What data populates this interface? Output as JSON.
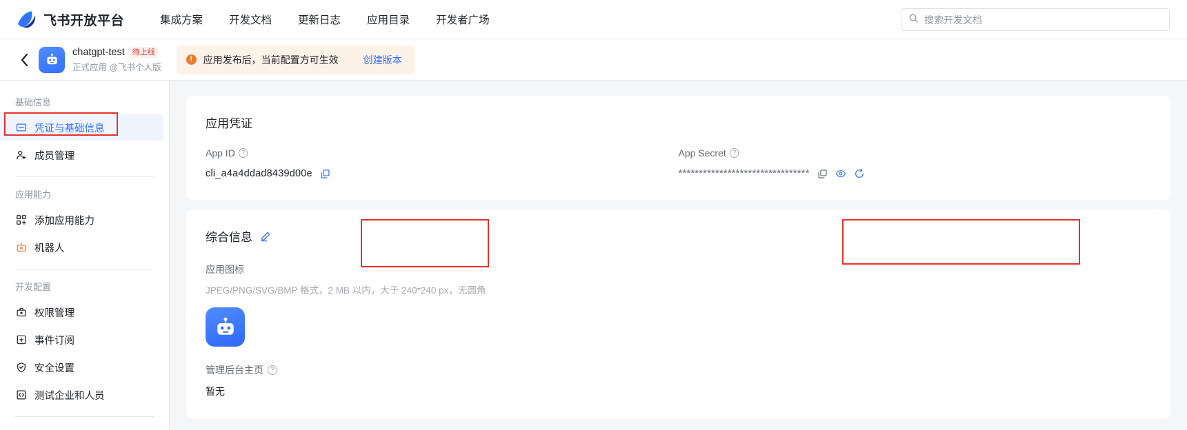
{
  "topnav": {
    "brand": "飞书开放平台",
    "links": [
      {
        "label": "集成方案"
      },
      {
        "label": "开发文档"
      },
      {
        "label": "更新日志"
      },
      {
        "label": "应用目录"
      },
      {
        "label": "开发者广场"
      }
    ],
    "search": {
      "placeholder": "搜索开发文档",
      "value": "",
      "icon": "search-icon"
    }
  },
  "app_header": {
    "back_icon": "chevron-left-icon",
    "app_icon": "robot-app-icon",
    "app_name": "chatgpt-test",
    "status_badge": "待上线",
    "app_subtitle": "正式应用 @飞书个人版",
    "banner": {
      "icon": "warning-icon",
      "text": "应用发布后，当前配置方可生效",
      "link_label": "创建版本",
      "bg_color": "#fdf2e8",
      "icon_color": "#ed7b2f",
      "link_color": "#3370ff"
    }
  },
  "sidebar": {
    "groups": [
      {
        "title": "基础信息",
        "items": [
          {
            "label": "凭证与基础信息",
            "icon": "credential-card-icon",
            "active": true
          },
          {
            "label": "成员管理",
            "icon": "user-add-icon",
            "active": false
          }
        ]
      },
      {
        "title": "应用能力",
        "items": [
          {
            "label": "添加应用能力",
            "icon": "grid-add-icon",
            "active": false
          },
          {
            "label": "机器人",
            "icon": "robot-icon",
            "active": false
          }
        ]
      },
      {
        "title": "开发配置",
        "items": [
          {
            "label": "权限管理",
            "icon": "briefcase-lock-icon",
            "active": false
          },
          {
            "label": "事件订阅",
            "icon": "square-plus-icon",
            "active": false
          },
          {
            "label": "安全设置",
            "icon": "shield-check-icon",
            "active": false
          },
          {
            "label": "测试企业和人员",
            "icon": "code-brackets-icon",
            "active": false
          }
        ]
      }
    ],
    "active_color": "#3370ff",
    "active_bg": "#eff4ff"
  },
  "credentials_card": {
    "title": "应用凭证",
    "app_id": {
      "label": "App ID",
      "help_icon": "question-mark-icon",
      "value": "cli_a4a4ddad8439d00e",
      "copy_icon": "copy-icon"
    },
    "app_secret": {
      "label": "App Secret",
      "help_icon": "question-mark-icon",
      "value": "********************************",
      "copy_icon": "copy-icon",
      "eye_icon": "eye-icon",
      "refresh_icon": "refresh-icon"
    }
  },
  "info_card": {
    "title": "综合信息",
    "edit_icon": "pencil-edit-icon",
    "app_icon_label": "应用图标",
    "app_icon_desc": "JPEG/PNG/SVG/BMP 格式，2 MB 以内，大于 240*240 px，无圆角",
    "app_icon_name": "robot-app-icon",
    "admin_home_label": "管理后台主页",
    "admin_home_help_icon": "question-mark-icon",
    "admin_home_value": "暂无"
  },
  "annotations": {
    "color": "#e8312a",
    "boxes": [
      {
        "name": "highlight-sidebar-credentials"
      },
      {
        "name": "highlight-app-id"
      },
      {
        "name": "highlight-app-secret"
      }
    ]
  }
}
